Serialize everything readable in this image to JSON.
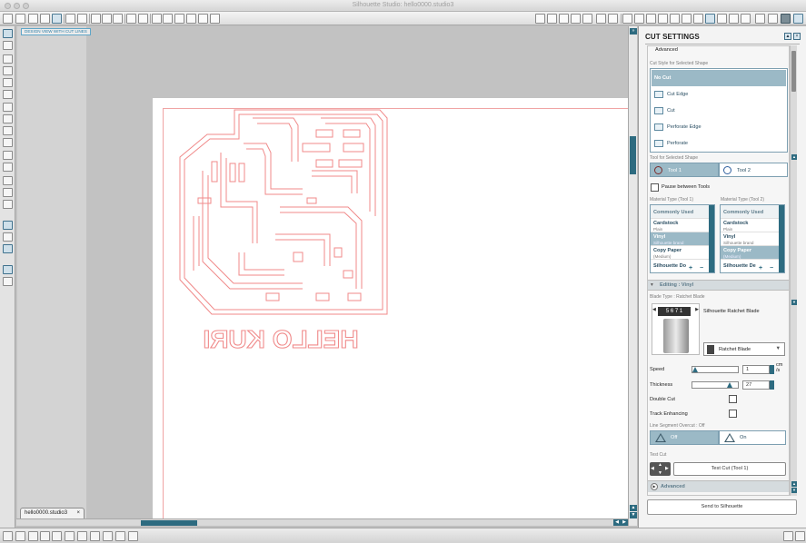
{
  "window": {
    "title": "Silhouette Studio: hello0000.studio3"
  },
  "design_view": {
    "label": "DESIGN VIEW WITH CUT LINES"
  },
  "design": {
    "text": "HELLO KURI"
  },
  "document_tab": {
    "name": "hello0000.studio3",
    "close": "×"
  },
  "panel": {
    "title": "CUT SETTINGS",
    "advanced_top": "Advanced",
    "cut_style": {
      "label": "Cut Style for Selected Shape",
      "options": [
        "No Cut",
        "Cut Edge",
        "Cut",
        "Perforate Edge",
        "Perforate"
      ],
      "selected": "No Cut"
    },
    "tool": {
      "label": "Tool for Selected Shape",
      "tool1": "Tool 1",
      "tool2": "Tool 2",
      "pause": "Pause between Tools"
    },
    "material": {
      "label1": "Material Type (Tool 1)",
      "label2": "Material Type (Tool 2)",
      "header": "Commonly Used",
      "list1": [
        {
          "name": "Cardstock",
          "sub": "Plain"
        },
        {
          "name": "Vinyl",
          "sub": "Silhouette brand"
        },
        {
          "name": "Copy Paper",
          "sub": "(Medium)"
        },
        {
          "name": "Silhouette Do",
          "sub": ""
        }
      ],
      "list2": [
        {
          "name": "Cardstock",
          "sub": "Plain"
        },
        {
          "name": "Vinyl",
          "sub": "Silhouette brand"
        },
        {
          "name": "Copy Paper",
          "sub": "(Medium)"
        },
        {
          "name": "Silhouette De",
          "sub": ""
        }
      ],
      "plus": "+",
      "minus": "−"
    },
    "editing": "Editing : Vinyl",
    "blade": {
      "label": "Blade Type : Ratchet Blade",
      "name": "Silhouette Ratchet Blade",
      "dropdown": "Ratchet Blade",
      "dial": "5 6 7 1"
    },
    "speed": {
      "label": "Speed",
      "value": "1",
      "unit": "cm /s",
      "fraction": 0.0
    },
    "thickness": {
      "label": "Thickness",
      "value": "27",
      "fraction": 0.82
    },
    "double_cut": "Double Cut",
    "track_enhancing": "Track Enhancing",
    "overcut": {
      "label": "Line Segment Overcut : Off",
      "off": "Off",
      "on": "On"
    },
    "test_cut": {
      "label": "Test Cut",
      "button": "Test Cut (Tool 1)"
    },
    "advanced": "Advanced",
    "send": "Send to Silhouette"
  },
  "colors": {
    "accent": "#2d6b80",
    "selected_row": "#9bb9c6",
    "cut_line": "#f08a8a"
  }
}
